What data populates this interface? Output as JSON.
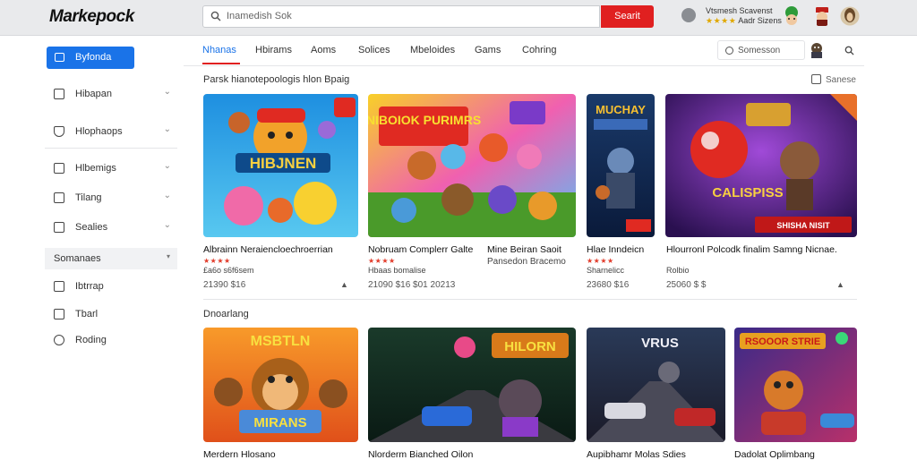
{
  "header": {
    "logo": "Markepock",
    "search_placeholder": "Inamedish Sok",
    "search_button": "Searit",
    "account_line1": "Vtsmesh Scavenst",
    "account_line2": "Aadr Sizens",
    "account_stars": "★★★★"
  },
  "sidebar": {
    "active_label": "Byfonda",
    "items": [
      {
        "label": "Hibapan"
      },
      {
        "label": "Hlophaops"
      },
      {
        "label": "Hlbemigs"
      },
      {
        "label": "Tilang"
      },
      {
        "label": "Sealies"
      }
    ],
    "section_label": "Somanaes",
    "sub_items": [
      {
        "label": "Ibtrrap"
      },
      {
        "label": "Tbarl"
      },
      {
        "label": "Roding"
      }
    ]
  },
  "tabs": {
    "items": [
      "Nhanas",
      "Hbirams",
      "Aoms",
      "Solices",
      "Mbeloides",
      "Gams",
      "Cohring"
    ],
    "search_label": "Somesson"
  },
  "sections": [
    {
      "title": "Parsk hianotepoologis hlon Bpaig",
      "link": "Sanese",
      "cards": [
        {
          "title": "Albrainn Neraiencloechroerrian",
          "stars": "★★★★",
          "sub": "£a6o s6f6sem",
          "price": "21390  $16"
        },
        {
          "title": "Nobruam Complerr Galte",
          "stars": "★★★★",
          "sub": "Hbaas bomalise",
          "price": "21090  $16    $01 20213"
        },
        {
          "title": "Mine Beiran Saoit",
          "stars": "",
          "sub": "Pansedon Bracemo",
          "price": ""
        },
        {
          "title": "Hlae Inndeicn",
          "stars": "★★★★",
          "sub": "Sharnelicc",
          "price": "23680  $16"
        },
        {
          "title": "Hlourronl Polcodk finalim Samng Nicnae.",
          "stars": "",
          "sub": "Rolbio",
          "price": "25060  $ $"
        }
      ]
    },
    {
      "title": "Dnoarlang",
      "cards": [
        {
          "title": "Merdern Hlosano"
        },
        {
          "title": "Nlorderm Bianched Oilon"
        },
        {
          "title": "Aupibhamr Molas Sdies"
        },
        {
          "title": "Dadolat Oplimbang"
        }
      ]
    }
  ],
  "thumbnails": {
    "t1_text": "HIBJNEN",
    "t2_text": "NIBOIOK PURIMRS",
    "t3_text": "MUCHAY",
    "t4_text": "CALISPISS",
    "t4_banner": "SHISHA NISIT",
    "t5_text": "MSBTLN",
    "t5_sub": "MIRANS",
    "t6_text": "HILORN",
    "t7_text": "VRUS",
    "t8_text": "RSOOOR STRIE"
  }
}
